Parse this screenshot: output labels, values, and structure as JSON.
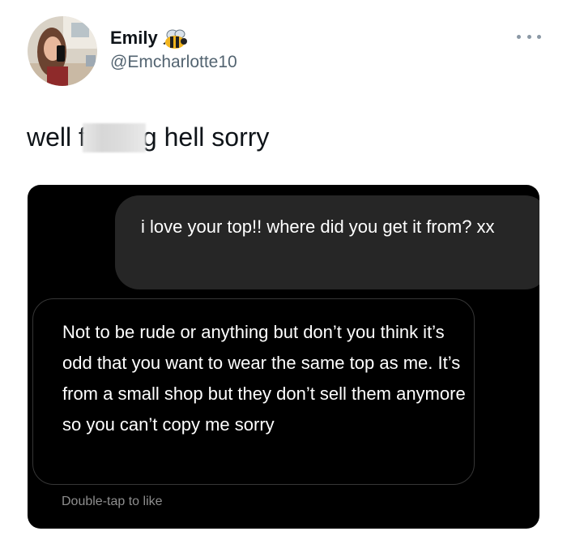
{
  "user": {
    "display_name": "Emily",
    "handle": "@Emcharlotte10",
    "name_emoji_icon": "bee-icon"
  },
  "tweet": {
    "text_start": "well f",
    "text_end": "g hell sorry",
    "censor_note": "blurred-out letters"
  },
  "screenshot": {
    "sent_message": "i love your top!! where did you get it from? xx",
    "received_message": "Not to be rude or anything but don’t you think it’s odd that you want to wear the same top as me. It’s from a small shop but they don’t sell them anymore so you can’t copy me sorry",
    "reaction_hint": "Double-tap to like"
  },
  "colors": {
    "text_primary": "#0f1419",
    "text_secondary": "#536471",
    "dm_background": "#000000",
    "sent_bubble": "#262626",
    "received_border": "#363636",
    "hint_text": "#8e8e8e"
  }
}
